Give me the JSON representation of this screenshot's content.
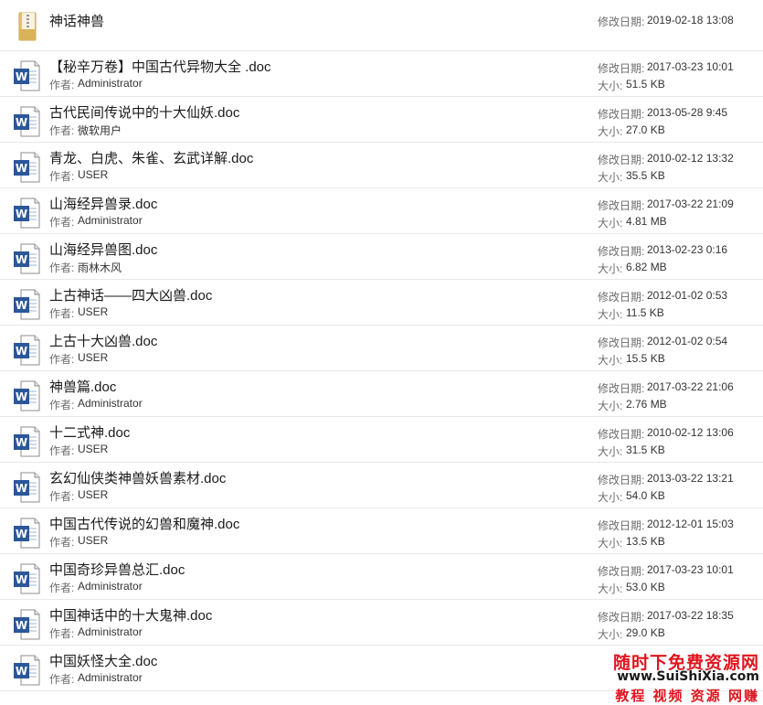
{
  "labels": {
    "modified": "修改日期:",
    "size": "大小:",
    "author": "作者:"
  },
  "folder": {
    "name": "神话神兽",
    "modified": "2019-02-18 13:08"
  },
  "files": [
    {
      "name": "【秘辛万卷】中国古代异物大全 .doc",
      "author": "Administrator",
      "modified": "2017-03-23 10:01",
      "size": "51.5 KB"
    },
    {
      "name": "古代民间传说中的十大仙妖.doc",
      "author": "微软用户",
      "modified": "2013-05-28 9:45",
      "size": "27.0 KB"
    },
    {
      "name": "青龙、白虎、朱雀、玄武详解.doc",
      "author": "USER",
      "modified": "2010-02-12 13:32",
      "size": "35.5 KB"
    },
    {
      "name": "山海经异兽录.doc",
      "author": "Administrator",
      "modified": "2017-03-22 21:09",
      "size": "4.81 MB"
    },
    {
      "name": "山海经异兽图.doc",
      "author": "雨林木风",
      "modified": "2013-02-23 0:16",
      "size": "6.82 MB"
    },
    {
      "name": "上古神话——四大凶兽.doc",
      "author": "USER",
      "modified": "2012-01-02 0:53",
      "size": "11.5 KB"
    },
    {
      "name": "上古十大凶兽.doc",
      "author": "USER",
      "modified": "2012-01-02 0:54",
      "size": "15.5 KB"
    },
    {
      "name": "神兽篇.doc",
      "author": "Administrator",
      "modified": "2017-03-22 21:06",
      "size": "2.76 MB"
    },
    {
      "name": "十二式神.doc",
      "author": "USER",
      "modified": "2010-02-12 13:06",
      "size": "31.5 KB"
    },
    {
      "name": "玄幻仙侠类神兽妖兽素材.doc",
      "author": "USER",
      "modified": "2013-03-22 13:21",
      "size": "54.0 KB"
    },
    {
      "name": "中国古代传说的幻兽和魔神.doc",
      "author": "USER",
      "modified": "2012-12-01 15:03",
      "size": "13.5 KB"
    },
    {
      "name": "中国奇珍异兽总汇.doc",
      "author": "Administrator",
      "modified": "2017-03-23 10:01",
      "size": "53.0 KB"
    },
    {
      "name": "中国神话中的十大鬼神.doc",
      "author": "Administrator",
      "modified": "2017-03-22 18:35",
      "size": "29.0 KB"
    },
    {
      "name": "中国妖怪大全.doc",
      "author": "Administrator",
      "modified": "",
      "size": ""
    }
  ],
  "watermark": {
    "line1": "随时下免费资源网",
    "line2": "www.SuiShiXia.com",
    "line3": "教程 视频 资源 网赚"
  },
  "colors": {
    "word_blue": "#2b579a",
    "folder_yellow": "#e8c46a",
    "watermark_red": "#e0141e"
  }
}
